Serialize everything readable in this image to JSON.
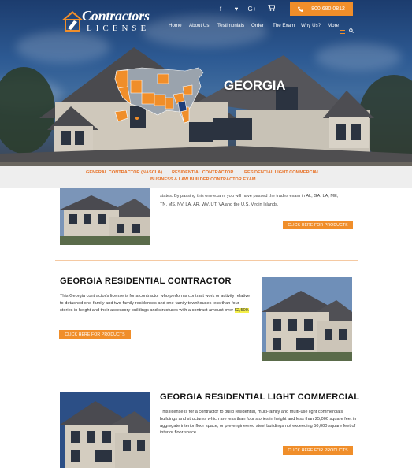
{
  "brand": {
    "name_line1": "Contractors",
    "name_line2": "LICENSE"
  },
  "topbar": {
    "social_icons": [
      "facebook-icon",
      "twitter-icon",
      "google-plus-icon"
    ],
    "social_glyphs": [
      "f",
      "♥",
      "G+"
    ],
    "cart_icon": "cart-icon",
    "phone": "800.680.0812",
    "phone_icon": "phone-icon"
  },
  "nav": {
    "items": [
      "Home",
      "About Us",
      "Testimonials",
      "Order",
      "The Exam",
      "Why Us?",
      "More"
    ],
    "menu_icon": "menu-icon",
    "search_icon": "search-icon"
  },
  "hero": {
    "title": "GEORGIA"
  },
  "subnav": {
    "items": [
      "GENERAL CONTRACTOR (NASCLA)",
      "RESIDENTIAL CONTRACTOR",
      "RESIDENTIAL LIGHT COMMERCIAL",
      "BUSINESS & LAW BUILDER CONTRACTOR EXAM"
    ]
  },
  "sections": [
    {
      "partial_text_1": "states. By passing this one exam, you will have passed the trades exam in AL, GA, LA, ME,",
      "partial_text_2": "TN, MS, NV, LA, AR, WV, UT, VA and the U.S. Virgin Islands.",
      "cta": "CLICK HERE FOR PRODUCTS"
    },
    {
      "title": "GEORGIA RESIDENTIAL CONTRACTOR",
      "text": "This Georgia contractor's license is for a contractor who performs contract work or activity relative to detached one-family and two-family residences and one-family townhouses less than four stories in height and their accessory buildings and structures with a contract amount over",
      "highlight": "$2,500.",
      "cta": "CLICK HERE FOR PRODUCTS"
    },
    {
      "title": "GEORGIA RESIDENTIAL LIGHT COMMERCIAL",
      "text": "This license is for a contractor to build residential, multi-family and multi-use light commercials buildings and structures which are less than four stories in height and less than 25,000 square feet in aggregate interior floor space, or pre-engineered steel buildings not exceeding 50,000 square feet of interior floor space.",
      "cta": "CLICK HERE FOR PRODUCTS"
    }
  ],
  "colors": {
    "accent": "#f08e2a",
    "subnav_link": "#e8742a",
    "map_highlight": "#f08e2a",
    "map_selected": "#1d3e7a"
  }
}
